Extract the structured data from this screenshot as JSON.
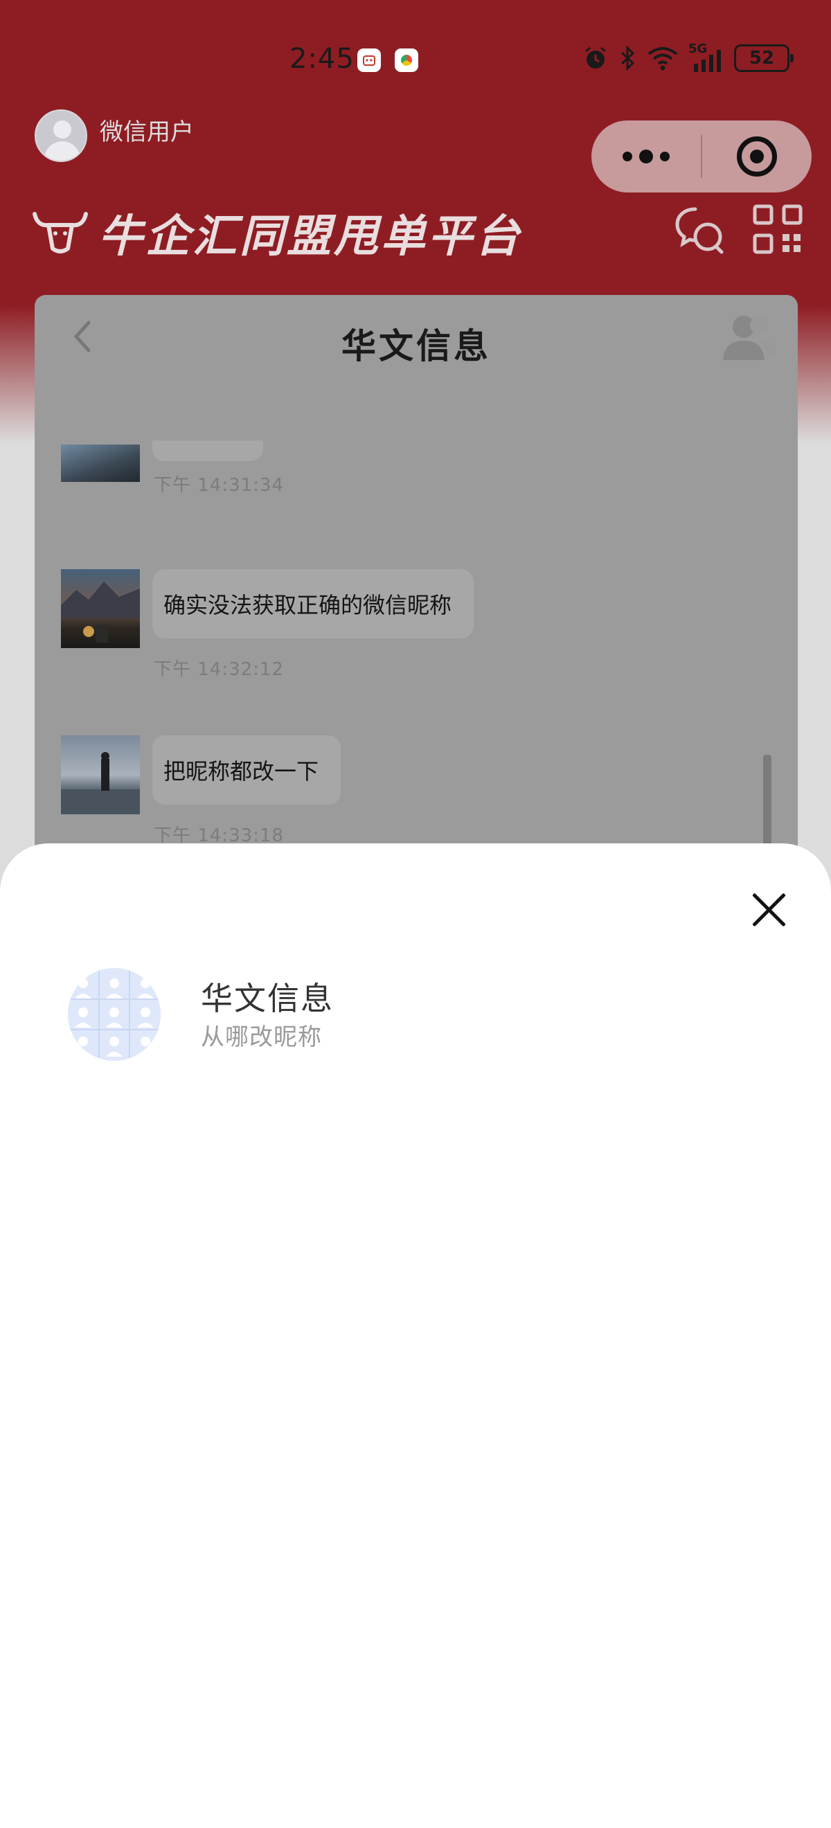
{
  "status_bar": {
    "time": "2:45",
    "network": "5G",
    "battery": "52"
  },
  "header": {
    "user_name": "微信用户",
    "brand_title": "牛企汇同盟甩单平台"
  },
  "chat": {
    "title": "华文信息",
    "messages": [
      {
        "text": "",
        "time": "下午 14:31:34"
      },
      {
        "text": "确实没法获取正确的微信昵称",
        "time": "下午 14:32:12"
      },
      {
        "text": "把昵称都改一下",
        "time": "下午 14:33:18"
      }
    ]
  },
  "sheet": {
    "group_name": "华文信息",
    "group_subtitle": "从哪改昵称"
  },
  "colors": {
    "brand_red": "#8e1d23",
    "overlay_gray": "#9b9b9b",
    "sheet_bg": "#ffffff"
  },
  "icons": [
    "robot-notification-icon",
    "chrome-notification-icon",
    "alarm-icon",
    "bluetooth-icon",
    "wifi-icon",
    "signal-icon",
    "battery-icon",
    "more-dots-icon",
    "close-miniprogram-icon",
    "bull-logo-icon",
    "chat-bubbles-icon",
    "qr-code-icon",
    "back-chevron-icon",
    "group-members-icon",
    "close-x-icon"
  ]
}
